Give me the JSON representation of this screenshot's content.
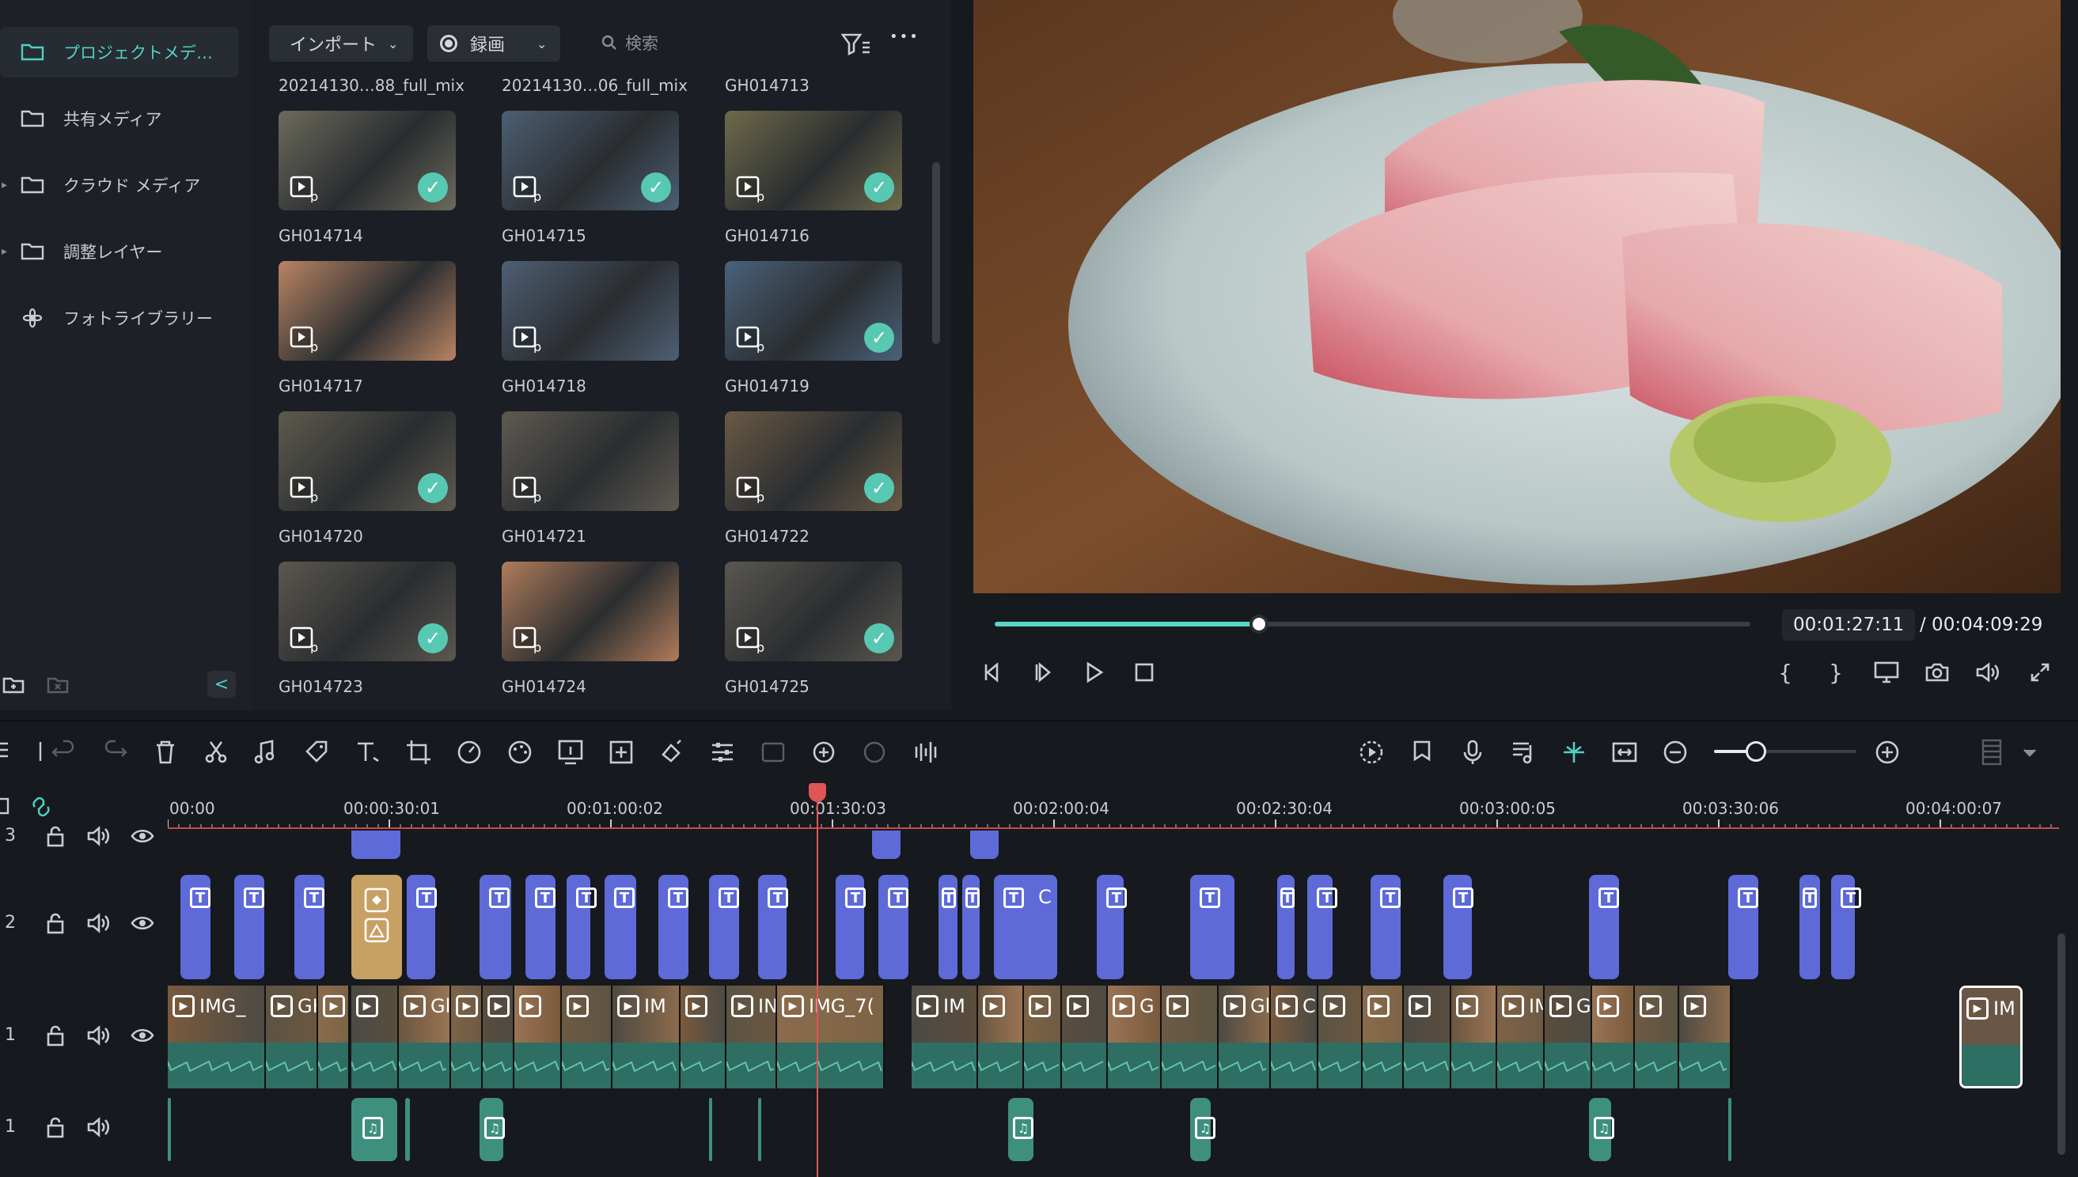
{
  "sidebar": {
    "items": [
      {
        "label": "プロジェクトメデ…",
        "icon": "folder-icon",
        "active": true,
        "caret": false
      },
      {
        "label": "共有メディア",
        "icon": "folder-icon",
        "active": false,
        "caret": false
      },
      {
        "label": "クラウド メディア",
        "icon": "folder-icon",
        "active": false,
        "caret": true
      },
      {
        "label": "調整レイヤー",
        "icon": "folder-icon",
        "active": false,
        "caret": true
      },
      {
        "label": "フォトライブラリー",
        "icon": "flower-icon",
        "active": false,
        "caret": false
      }
    ],
    "collapse_glyph": "<"
  },
  "media": {
    "import_label": "インポート",
    "record_label": "録画",
    "search_placeholder": "検索",
    "more_glyph": "•••",
    "top_captions": [
      "20214130…88_full_mix",
      "20214130…06_full_mix",
      "GH014713"
    ],
    "clips": [
      {
        "name": "GH014714",
        "checked": true,
        "tone": "#6b6a5c"
      },
      {
        "name": "GH014715",
        "checked": true,
        "tone": "#4c5f73"
      },
      {
        "name": "GH014716",
        "checked": true,
        "tone": "#6e6a4a"
      },
      {
        "name": "GH014717",
        "checked": false,
        "tone": "#b98462"
      },
      {
        "name": "GH014718",
        "checked": false,
        "tone": "#4e5f74"
      },
      {
        "name": "GH014719",
        "checked": true,
        "tone": "#4a627b"
      },
      {
        "name": "GH014720",
        "checked": true,
        "tone": "#5e5a4e"
      },
      {
        "name": "GH014721",
        "checked": false,
        "tone": "#5f5a52"
      },
      {
        "name": "GH014722",
        "checked": true,
        "tone": "#6a5a45"
      },
      {
        "name": "GH014723",
        "checked": true,
        "tone": "#5c574f"
      },
      {
        "name": "GH014724",
        "checked": false,
        "tone": "#b07c5a"
      },
      {
        "name": "GH014725",
        "checked": true,
        "tone": "#5a574f"
      }
    ]
  },
  "preview": {
    "current_time": "00:01:27:11",
    "total_time": "/ 00:04:09:29",
    "progress": 0.35,
    "bracket_open": "{",
    "bracket_close": "}"
  },
  "timeline": {
    "ruler": [
      "00:00",
      "00:00:30:01",
      "00:01:00:02",
      "00:01:30:03",
      "00:02:00:04",
      "00:02:30:04",
      "00:03:00:05",
      "00:03:30:06",
      "00:04:00:07"
    ],
    "tracks": {
      "t3": "3",
      "t2": "2",
      "v1": "1",
      "a1": "1"
    },
    "title_c_label": "C",
    "video_labels": [
      "IMG_",
      "GHC",
      "0…",
      "Gl",
      "C",
      "IM",
      "IN",
      "IMG_7(",
      "IM",
      "G",
      "Gl",
      "C",
      "IM",
      "GH",
      "IM"
    ]
  },
  "colors": {
    "accent": "#4fd1c5",
    "title_clip": "#5d6ad8",
    "audio_clip": "#3e8f7e",
    "playhead": "#e05555"
  }
}
